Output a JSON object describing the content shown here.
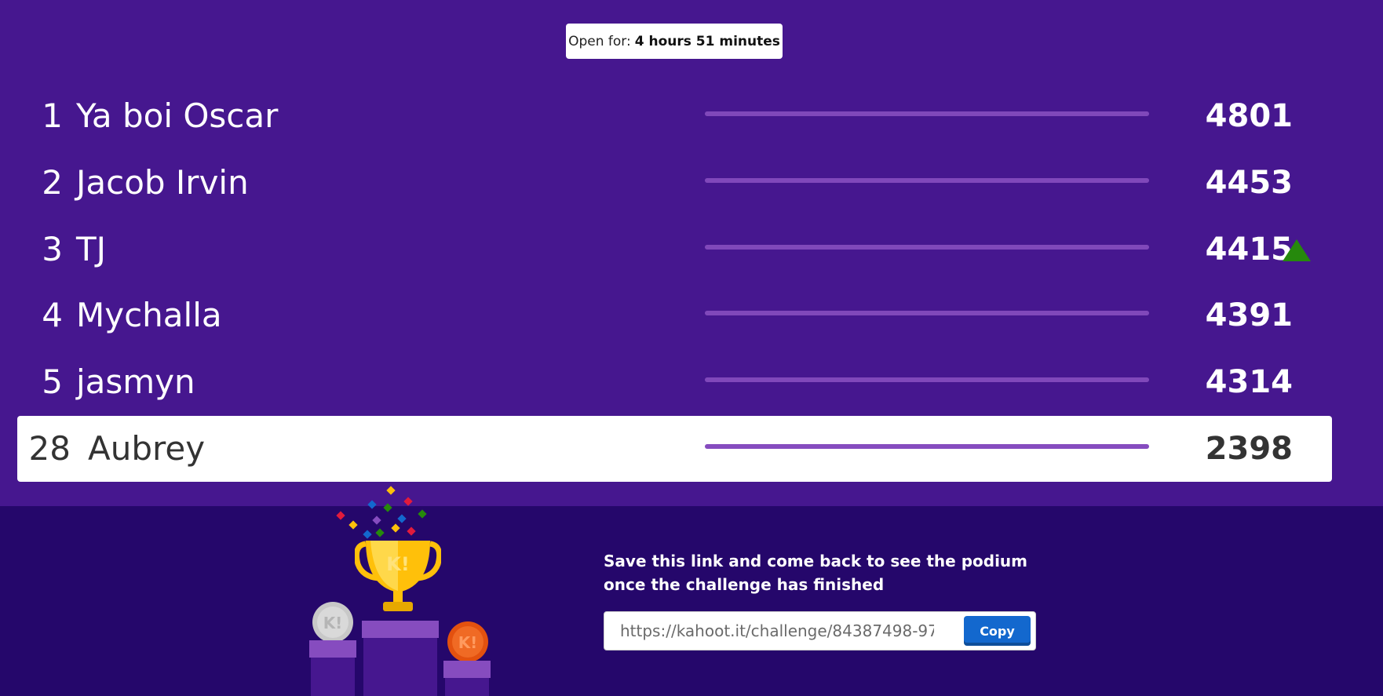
{
  "header": {
    "timer_label": "Open for:",
    "timer_value": "4 hours 51 minutes"
  },
  "leaderboard": {
    "rows": [
      {
        "rank": "1",
        "name": "Ya boi Oscar",
        "score": "4801",
        "progress": 1.0
      },
      {
        "rank": "2",
        "name": "Jacob Irvin",
        "score": "4453",
        "progress": 1.0
      },
      {
        "rank": "3",
        "name": "TJ",
        "score": "4415",
        "progress": 1.0,
        "moved_up": true
      },
      {
        "rank": "4",
        "name": "Mychalla",
        "score": "4391",
        "progress": 1.0
      },
      {
        "rank": "5",
        "name": "jasmyn",
        "score": "4314",
        "progress": 1.0
      }
    ],
    "me": {
      "rank": "28",
      "name": "Aubrey",
      "score": "2398",
      "progress": 1.0
    }
  },
  "footer": {
    "save_text": "Save this link and come back to see the podium once the challenge has finished",
    "link_value": "https://kahoot.it/challenge/84387498-97...",
    "copy_label": "Copy",
    "trophy_letter": "K!"
  },
  "colors": {
    "background": "#46178f",
    "footer_bg": "#25076b",
    "bar": "#864cbf",
    "arrow_up": "#26890c",
    "copy_button": "#1368ce",
    "gold": "#ffc00a",
    "silver": "#c8c8c8",
    "bronze": "#e3510f"
  }
}
